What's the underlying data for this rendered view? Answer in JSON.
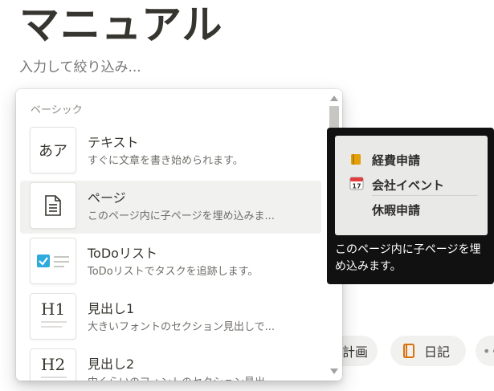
{
  "page": {
    "title": "マニュアル"
  },
  "filter": {
    "placeholder": "入力して絞り込み..."
  },
  "menu": {
    "section": "ベーシック",
    "items": [
      {
        "title": "テキスト",
        "desc": "すぐに文章を書き始められます。",
        "icon": "text-glyph-icon",
        "icon_text": "あア"
      },
      {
        "title": "ページ",
        "desc": "このページ内に子ページを埋め込みま...",
        "icon": "page-icon"
      },
      {
        "title": "ToDoリスト",
        "desc": "ToDoリストでタスクを追跡します。",
        "icon": "checkbox-icon"
      },
      {
        "title": "見出し1",
        "desc": "大きいフォントのセクション見出しで...",
        "icon": "heading-1-icon",
        "icon_text": "H1"
      },
      {
        "title": "見出し2",
        "desc": "中くらいのフォントのセクション見出...",
        "icon": "heading-2-icon",
        "icon_text": "H2"
      }
    ]
  },
  "preview": {
    "rows": [
      {
        "icon": "folder-icon",
        "label": "経費申請"
      },
      {
        "icon": "calendar-icon",
        "icon_text": "17",
        "label": "会社イベント"
      },
      {
        "icon": "",
        "label": "休暇申請"
      }
    ],
    "caption": "このページ内に子ページを埋め込みます。"
  },
  "chips": [
    {
      "label": "計画"
    },
    {
      "label": "日記",
      "icon": "book-icon"
    },
    {
      "label": "",
      "icon": "more-icon"
    }
  ],
  "colors": {
    "accent": "#2eaadc",
    "chip_icon": "#d9730d",
    "preview_bg": "#111111"
  }
}
